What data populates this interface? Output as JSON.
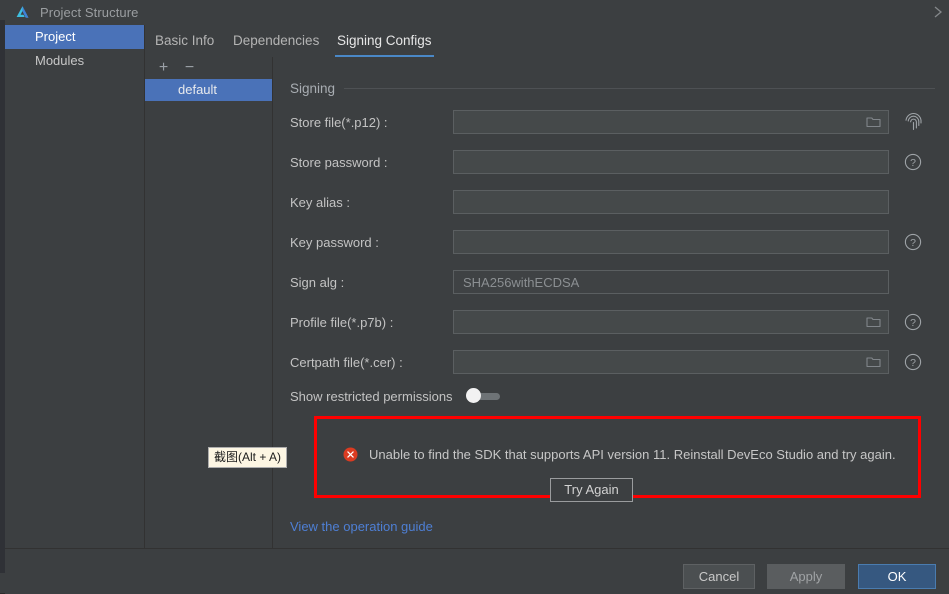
{
  "window": {
    "title": "Project Structure",
    "logo_icon": "deveco-logo-icon",
    "close_icon": "close-chevron-icon"
  },
  "sidebar": {
    "items": [
      {
        "label": "Project",
        "selected": true
      },
      {
        "label": "Modules",
        "selected": false
      }
    ]
  },
  "tabs": [
    {
      "label": "Basic Info",
      "active": false
    },
    {
      "label": "Dependencies",
      "active": false
    },
    {
      "label": "Signing Configs",
      "active": true
    }
  ],
  "config_list": {
    "add_label": "+",
    "remove_label": "−",
    "items": [
      {
        "label": "default",
        "selected": true
      }
    ]
  },
  "signing": {
    "group_title": "Signing",
    "fields": [
      {
        "label": "Store file(*.p12) :",
        "value": "",
        "placeholder": "",
        "folder": true,
        "trailing": "fingerprint-icon",
        "readonly": false
      },
      {
        "label": "Store password :",
        "value": "",
        "placeholder": "",
        "folder": false,
        "trailing": "help-icon",
        "readonly": false
      },
      {
        "label": "Key alias :",
        "value": "",
        "placeholder": "",
        "folder": false,
        "trailing": "",
        "readonly": false
      },
      {
        "label": "Key password :",
        "value": "",
        "placeholder": "",
        "folder": false,
        "trailing": "help-icon",
        "readonly": false
      },
      {
        "label": "Sign alg :",
        "value": "SHA256withECDSA",
        "placeholder": "",
        "folder": false,
        "trailing": "",
        "readonly": true
      },
      {
        "label": "Profile file(*.p7b) :",
        "value": "",
        "placeholder": "",
        "folder": true,
        "trailing": "help-icon",
        "readonly": false
      },
      {
        "label": "Certpath file(*.cer) :",
        "value": "",
        "placeholder": "",
        "folder": true,
        "trailing": "help-icon",
        "readonly": false
      }
    ],
    "toggle": {
      "label": "Show restricted permissions",
      "on": false
    }
  },
  "error": {
    "icon": "error-circle-icon",
    "message": "Unable to find the SDK that supports API version 11. Reinstall DevEco Studio and try again.",
    "button_label": "Try Again",
    "border_color": "#fe0000"
  },
  "guide_link": "View the operation guide",
  "tooltip": {
    "text": "截图(Alt + A)"
  },
  "footer": {
    "cancel_label": "Cancel",
    "apply_label": "Apply",
    "ok_label": "OK"
  },
  "colors": {
    "window_bg": "#3c3f41",
    "selection_blue": "#4a72b8",
    "tab_underline": "#4a88c7",
    "link_blue": "#4e7fd4",
    "ok_button": "#365880",
    "error_red": "#fe0000"
  }
}
